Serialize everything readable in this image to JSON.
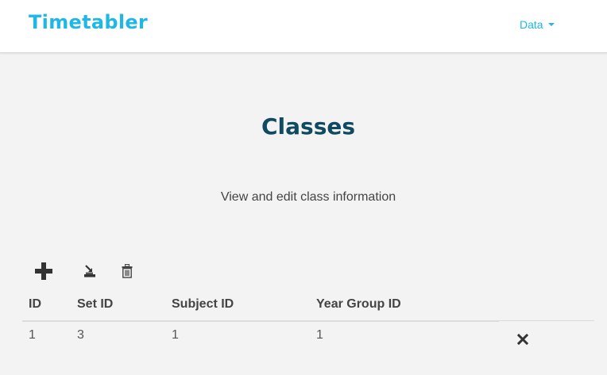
{
  "navbar": {
    "brand": "Timetabler",
    "menu_label": "Data",
    "accent_color": "#1fb8e6"
  },
  "page": {
    "title": "Classes",
    "subtitle": "View and edit class information",
    "title_color": "#104a61"
  },
  "toolbar": {
    "icons": [
      "plus-icon",
      "import-icon",
      "trash-icon"
    ]
  },
  "table": {
    "columns": [
      "ID",
      "Set ID",
      "Subject ID",
      "Year Group ID"
    ],
    "rows": [
      {
        "id": "1",
        "set_id": "3",
        "subject_id": "1",
        "year_group_id": "1"
      }
    ],
    "row_action_icon": "close-icon"
  }
}
